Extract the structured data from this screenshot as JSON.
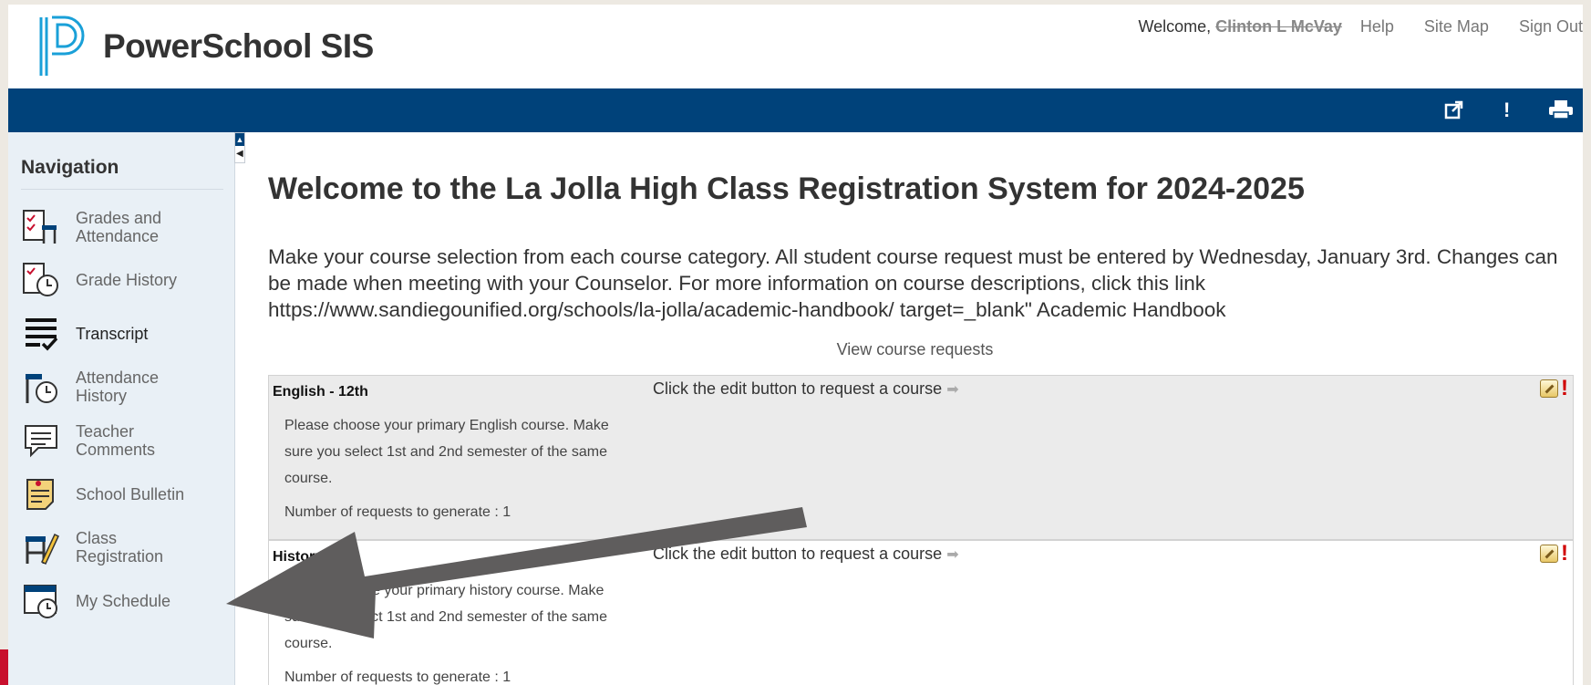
{
  "header": {
    "app_name": "PowerSchool SIS",
    "welcome_prefix": "Welcome,",
    "user_name": "Clinton L McVay",
    "links": {
      "help": "Help",
      "site_map": "Site Map",
      "sign_out": "Sign Out"
    }
  },
  "toolbar_icons": [
    "external-link-icon",
    "alert-icon",
    "printer-icon"
  ],
  "sidebar": {
    "title": "Navigation",
    "items": [
      {
        "label": "Grades and Attendance",
        "icon": "grades-attendance-icon"
      },
      {
        "label": "Grade History",
        "icon": "grade-history-icon"
      },
      {
        "label": "Transcript",
        "icon": "transcript-icon"
      },
      {
        "label": "Attendance History",
        "icon": "attendance-history-icon"
      },
      {
        "label": "Teacher Comments",
        "icon": "teacher-comments-icon"
      },
      {
        "label": "School Bulletin",
        "icon": "school-bulletin-icon"
      },
      {
        "label": "Class Registration",
        "icon": "class-registration-icon"
      },
      {
        "label": "My Schedule",
        "icon": "my-schedule-icon"
      }
    ]
  },
  "main": {
    "heading": "Welcome to the La Jolla High Class Registration System for 2024-2025",
    "intro": "Make your course selection from each course category. All student course request must be entered by Wednesday, January 3rd. Changes can be made when meeting with your Counselor. For more information on course descriptions, click this link https://www.sandiegounified.org/schools/la-jolla/academic-handbook/ target=_blank\" Academic Handbook",
    "view_requests": "View course requests",
    "categories": [
      {
        "title": "English - 12th",
        "description": "Please choose your primary English course. Make sure you select 1st and 2nd semester of the same course.",
        "requests": "Number of requests to generate : 1",
        "instruction": "Click the edit button to request a course"
      },
      {
        "title": "History",
        "description": "Please choose your primary history course. Make sure you select 1st and 2nd semester of the same course.",
        "requests": "Number of requests to generate : 1",
        "instruction": "Click the edit button to request a course"
      }
    ]
  },
  "colors": {
    "brand_blue": "#00427a",
    "sidebar_bg": "#e9f0f6",
    "alert_red": "#d00000",
    "annotation_arrow": "#5f5d5d"
  }
}
